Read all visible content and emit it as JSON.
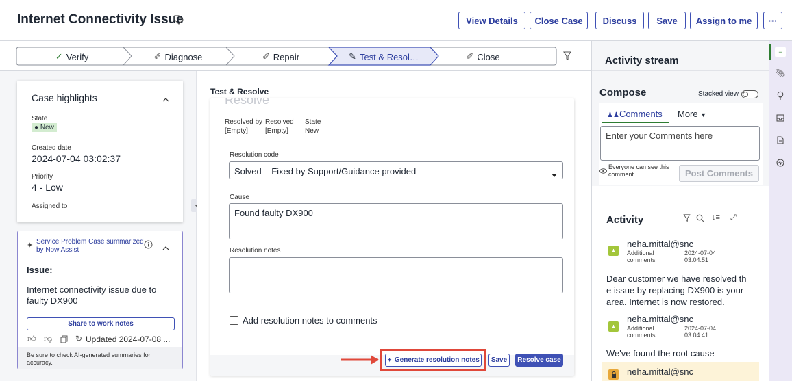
{
  "header": {
    "title": "Internet Connectivity Issue",
    "buttons": {
      "view_details": "View Details",
      "close_case": "Close Case",
      "discuss": "Discuss",
      "save": "Save",
      "assign_to_me": "Assign to me",
      "more": "···"
    }
  },
  "stages": [
    {
      "label": "Verify",
      "prefix": "✓"
    },
    {
      "label": "Diagnose",
      "prefix": "✐"
    },
    {
      "label": "Repair",
      "prefix": "✐"
    },
    {
      "label": "Test & Resol…",
      "prefix": "✎"
    },
    {
      "label": "Close",
      "prefix": "✐"
    }
  ],
  "highlights": {
    "title": "Case highlights",
    "state_label": "State",
    "state_value": "New",
    "created_label": "Created date",
    "created_value": "2024-07-04 03:02:37",
    "priority_label": "Priority",
    "priority_value": "4 - Low",
    "assigned_label": "Assigned to"
  },
  "assist": {
    "title": "Service Problem Case summarized by Now Assist",
    "issue_label": "Issue:",
    "issue_text": "Internet connectivity issue due to faulty DX900",
    "share_button": "Share to work notes",
    "updated": "Updated 2024-07-08 ...",
    "disclaimer": "Be sure to check AI-generated summaries for accuracy."
  },
  "form": {
    "section_title": "Test & Resolve",
    "ghost_title": "Resolve",
    "resolved_by_label": "Resolved by",
    "resolved_by_value": "[Empty]",
    "resolved_label": "Resolved",
    "resolved_value": "[Empty]",
    "state_label": "State",
    "state_value": "New",
    "resolution_code_label": "Resolution code",
    "resolution_code_value": "Solved – Fixed by Support/Guidance provided",
    "cause_label": "Cause",
    "cause_value": "Found faulty DX900",
    "notes_label": "Resolution notes",
    "notes_value": "",
    "add_notes_checkbox": "Add resolution notes to comments",
    "generate_button": "Generate resolution notes",
    "save_button": "Save",
    "resolve_button": "Resolve case"
  },
  "activity_stream": {
    "title": "Activity stream",
    "compose_title": "Compose",
    "stacked_view": "Stacked view",
    "tab_comments": "Comments",
    "tab_more": "More",
    "comment_placeholder": "Enter your Comments here",
    "visibility_note": "Everyone can see this comment",
    "post_button": "Post Comments",
    "activity_title": "Activity",
    "entries": [
      {
        "user": "neha.mittal@snc",
        "type": "Additional comments",
        "time": "2024-07-04 03:04:51",
        "text": "Dear customer we have resolved the issue by replacing DX900 is your area. Internet is now restored."
      },
      {
        "user": "neha.mittal@snc",
        "type": "Additional comments",
        "time": "2024-07-04 03:04:41",
        "text": "We've found the root cause"
      },
      {
        "user": "neha.mittal@snc"
      }
    ]
  },
  "colors": {
    "accent": "#3f51b5",
    "new_badge": "#d3ecd0",
    "highlight_red": "#e0483a",
    "sidebar_bg": "#ebe8f6"
  }
}
